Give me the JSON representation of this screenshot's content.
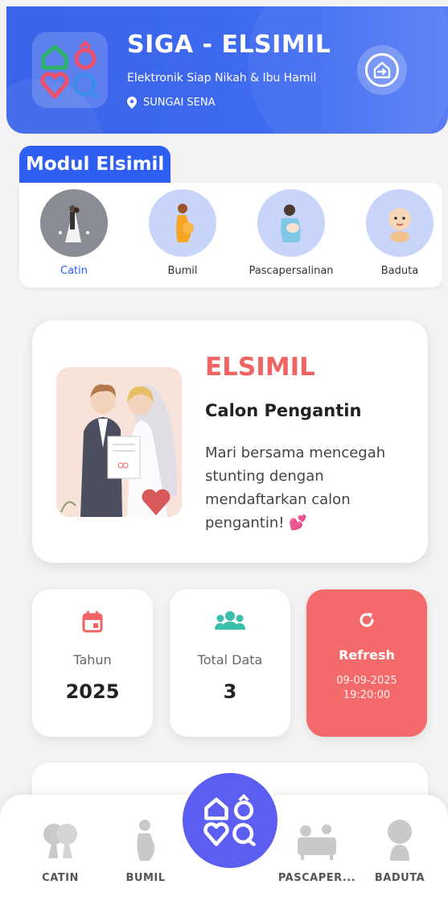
{
  "header": {
    "title": "SIGA - ELSIMIL",
    "subtitle": "Elektronik Siap Nikah & Ibu Hamil",
    "location": "SUNGAI SENA",
    "logo_icon": "siga-logo-icon",
    "exit_icon": "home-exit-icon"
  },
  "modul": {
    "heading": "Modul Elsimil",
    "items": [
      {
        "label": "Catin",
        "icon": "bride-groom-icon",
        "active": true
      },
      {
        "label": "Bumil",
        "icon": "pregnant-woman-icon"
      },
      {
        "label": "Pascapersalinan",
        "icon": "mother-baby-icon"
      },
      {
        "label": "Baduta",
        "icon": "baby-icon"
      }
    ]
  },
  "hero": {
    "title": "ELSIMIL",
    "subtitle": "Calon Pengantin",
    "description": "Mari bersama mencegah stunting dengan mendaftarkan calon pengantin! 💕"
  },
  "stats": {
    "year_label": "Tahun",
    "year_value": "2025",
    "total_label": "Total Data",
    "total_value": "3",
    "refresh_label": "Refresh",
    "refresh_date": "09-09-2025",
    "refresh_time": "19:20:00"
  },
  "nav": {
    "items": [
      {
        "label": "CATIN",
        "icon": "couple-icon"
      },
      {
        "label": "BUMIL",
        "icon": "pregnant-icon"
      },
      {
        "label": "PASCAPER...",
        "icon": "postpartum-icon"
      },
      {
        "label": "BADUTA",
        "icon": "child-icon"
      }
    ]
  },
  "colors": {
    "primary": "#3a63e8",
    "accent_red": "#f06464",
    "refresh_bg": "#f46a6a",
    "teal": "#3bbfad",
    "fab": "#5b5ef0"
  }
}
